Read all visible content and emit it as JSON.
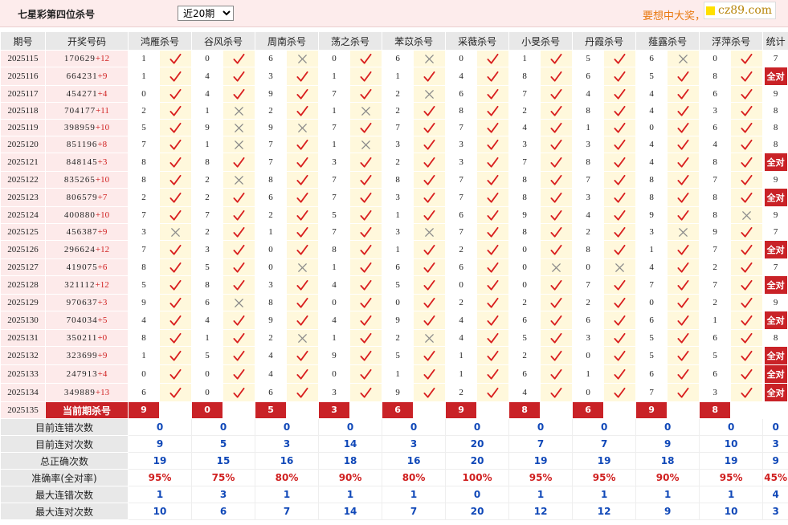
{
  "title": "七星彩第四位杀号",
  "period_select": {
    "value": "近20期"
  },
  "slogan": "要想中大奖，",
  "brand": "cz89.com",
  "headers": [
    "期号",
    "开奖号码",
    "鸿雁杀号",
    "谷风杀号",
    "周南杀号",
    "荡之杀号",
    "苯苡杀号",
    "采薇杀号",
    "小旻杀号",
    "丹霞杀号",
    "薤露杀号",
    "浮萍杀号",
    "统计"
  ],
  "rows": [
    {
      "period": "2025115",
      "digits": "170629",
      "add": "+12",
      "kills": [
        [
          "1",
          "y"
        ],
        [
          "0",
          "y"
        ],
        [
          "6",
          "n"
        ],
        [
          "0",
          "y"
        ],
        [
          "6",
          "n"
        ],
        [
          "0",
          "y"
        ],
        [
          "1",
          "y"
        ],
        [
          "5",
          "y"
        ],
        [
          "6",
          "n"
        ],
        [
          "0",
          "y"
        ]
      ],
      "stat": "7"
    },
    {
      "period": "2025116",
      "digits": "664231",
      "add": "+9",
      "kills": [
        [
          "1",
          "y"
        ],
        [
          "4",
          "y"
        ],
        [
          "3",
          "y"
        ],
        [
          "1",
          "y"
        ],
        [
          "1",
          "y"
        ],
        [
          "4",
          "y"
        ],
        [
          "8",
          "y"
        ],
        [
          "6",
          "y"
        ],
        [
          "5",
          "y"
        ],
        [
          "8",
          "y"
        ]
      ],
      "stat": "全对"
    },
    {
      "period": "2025117",
      "digits": "454271",
      "add": "+4",
      "kills": [
        [
          "0",
          "y"
        ],
        [
          "4",
          "y"
        ],
        [
          "9",
          "y"
        ],
        [
          "7",
          "y"
        ],
        [
          "2",
          "n"
        ],
        [
          "6",
          "y"
        ],
        [
          "7",
          "y"
        ],
        [
          "4",
          "y"
        ],
        [
          "4",
          "y"
        ],
        [
          "6",
          "y"
        ]
      ],
      "stat": "9"
    },
    {
      "period": "2025118",
      "digits": "704177",
      "add": "+11",
      "kills": [
        [
          "2",
          "y"
        ],
        [
          "1",
          "n"
        ],
        [
          "2",
          "y"
        ],
        [
          "1",
          "n"
        ],
        [
          "2",
          "y"
        ],
        [
          "8",
          "y"
        ],
        [
          "2",
          "y"
        ],
        [
          "8",
          "y"
        ],
        [
          "4",
          "y"
        ],
        [
          "3",
          "y"
        ]
      ],
      "stat": "8"
    },
    {
      "period": "2025119",
      "digits": "398959",
      "add": "+10",
      "kills": [
        [
          "5",
          "y"
        ],
        [
          "9",
          "n"
        ],
        [
          "9",
          "n"
        ],
        [
          "7",
          "y"
        ],
        [
          "7",
          "y"
        ],
        [
          "7",
          "y"
        ],
        [
          "4",
          "y"
        ],
        [
          "1",
          "y"
        ],
        [
          "0",
          "y"
        ],
        [
          "6",
          "y"
        ]
      ],
      "stat": "8"
    },
    {
      "period": "2025120",
      "digits": "851196",
      "add": "+8",
      "kills": [
        [
          "7",
          "y"
        ],
        [
          "1",
          "n"
        ],
        [
          "7",
          "y"
        ],
        [
          "1",
          "n"
        ],
        [
          "3",
          "y"
        ],
        [
          "3",
          "y"
        ],
        [
          "3",
          "y"
        ],
        [
          "3",
          "y"
        ],
        [
          "4",
          "y"
        ],
        [
          "4",
          "y"
        ]
      ],
      "stat": "8"
    },
    {
      "period": "2025121",
      "digits": "848145",
      "add": "+3",
      "kills": [
        [
          "8",
          "y"
        ],
        [
          "8",
          "y"
        ],
        [
          "7",
          "y"
        ],
        [
          "3",
          "y"
        ],
        [
          "2",
          "y"
        ],
        [
          "3",
          "y"
        ],
        [
          "7",
          "y"
        ],
        [
          "8",
          "y"
        ],
        [
          "4",
          "y"
        ],
        [
          "8",
          "y"
        ]
      ],
      "stat": "全对"
    },
    {
      "period": "2025122",
      "digits": "835265",
      "add": "+10",
      "kills": [
        [
          "8",
          "y"
        ],
        [
          "2",
          "n"
        ],
        [
          "8",
          "y"
        ],
        [
          "7",
          "y"
        ],
        [
          "8",
          "y"
        ],
        [
          "7",
          "y"
        ],
        [
          "8",
          "y"
        ],
        [
          "7",
          "y"
        ],
        [
          "8",
          "y"
        ],
        [
          "7",
          "y"
        ]
      ],
      "stat": "9"
    },
    {
      "period": "2025123",
      "digits": "806579",
      "add": "+7",
      "kills": [
        [
          "2",
          "y"
        ],
        [
          "2",
          "y"
        ],
        [
          "6",
          "y"
        ],
        [
          "7",
          "y"
        ],
        [
          "3",
          "y"
        ],
        [
          "7",
          "y"
        ],
        [
          "8",
          "y"
        ],
        [
          "3",
          "y"
        ],
        [
          "8",
          "y"
        ],
        [
          "8",
          "y"
        ]
      ],
      "stat": "全对"
    },
    {
      "period": "2025124",
      "digits": "400880",
      "add": "+10",
      "kills": [
        [
          "7",
          "y"
        ],
        [
          "7",
          "y"
        ],
        [
          "2",
          "y"
        ],
        [
          "5",
          "y"
        ],
        [
          "1",
          "y"
        ],
        [
          "6",
          "y"
        ],
        [
          "9",
          "y"
        ],
        [
          "4",
          "y"
        ],
        [
          "9",
          "y"
        ],
        [
          "8",
          "n"
        ]
      ],
      "stat": "9"
    },
    {
      "period": "2025125",
      "digits": "456387",
      "add": "+9",
      "kills": [
        [
          "3",
          "n"
        ],
        [
          "2",
          "y"
        ],
        [
          "1",
          "y"
        ],
        [
          "7",
          "y"
        ],
        [
          "3",
          "n"
        ],
        [
          "7",
          "y"
        ],
        [
          "8",
          "y"
        ],
        [
          "2",
          "y"
        ],
        [
          "3",
          "n"
        ],
        [
          "9",
          "y"
        ]
      ],
      "stat": "7"
    },
    {
      "period": "2025126",
      "digits": "296624",
      "add": "+12",
      "kills": [
        [
          "7",
          "y"
        ],
        [
          "3",
          "y"
        ],
        [
          "0",
          "y"
        ],
        [
          "8",
          "y"
        ],
        [
          "1",
          "y"
        ],
        [
          "2",
          "y"
        ],
        [
          "0",
          "y"
        ],
        [
          "8",
          "y"
        ],
        [
          "1",
          "y"
        ],
        [
          "7",
          "y"
        ]
      ],
      "stat": "全对"
    },
    {
      "period": "2025127",
      "digits": "419075",
      "add": "+6",
      "kills": [
        [
          "8",
          "y"
        ],
        [
          "5",
          "y"
        ],
        [
          "0",
          "n"
        ],
        [
          "1",
          "y"
        ],
        [
          "6",
          "y"
        ],
        [
          "6",
          "y"
        ],
        [
          "0",
          "n"
        ],
        [
          "0",
          "n"
        ],
        [
          "4",
          "y"
        ],
        [
          "2",
          "y"
        ]
      ],
      "stat": "7"
    },
    {
      "period": "2025128",
      "digits": "321112",
      "add": "+12",
      "kills": [
        [
          "5",
          "y"
        ],
        [
          "8",
          "y"
        ],
        [
          "3",
          "y"
        ],
        [
          "4",
          "y"
        ],
        [
          "5",
          "y"
        ],
        [
          "0",
          "y"
        ],
        [
          "0",
          "y"
        ],
        [
          "7",
          "y"
        ],
        [
          "7",
          "y"
        ],
        [
          "7",
          "y"
        ]
      ],
      "stat": "全对"
    },
    {
      "period": "2025129",
      "digits": "970637",
      "add": "+3",
      "kills": [
        [
          "9",
          "y"
        ],
        [
          "6",
          "n"
        ],
        [
          "8",
          "y"
        ],
        [
          "0",
          "y"
        ],
        [
          "0",
          "y"
        ],
        [
          "2",
          "y"
        ],
        [
          "2",
          "y"
        ],
        [
          "2",
          "y"
        ],
        [
          "0",
          "y"
        ],
        [
          "2",
          "y"
        ]
      ],
      "stat": "9"
    },
    {
      "period": "2025130",
      "digits": "704034",
      "add": "+5",
      "kills": [
        [
          "4",
          "y"
        ],
        [
          "4",
          "y"
        ],
        [
          "9",
          "y"
        ],
        [
          "4",
          "y"
        ],
        [
          "9",
          "y"
        ],
        [
          "4",
          "y"
        ],
        [
          "6",
          "y"
        ],
        [
          "6",
          "y"
        ],
        [
          "6",
          "y"
        ],
        [
          "1",
          "y"
        ]
      ],
      "stat": "全对"
    },
    {
      "period": "2025131",
      "digits": "350211",
      "add": "+0",
      "kills": [
        [
          "8",
          "y"
        ],
        [
          "1",
          "y"
        ],
        [
          "2",
          "n"
        ],
        [
          "1",
          "y"
        ],
        [
          "2",
          "n"
        ],
        [
          "4",
          "y"
        ],
        [
          "5",
          "y"
        ],
        [
          "3",
          "y"
        ],
        [
          "5",
          "y"
        ],
        [
          "6",
          "y"
        ]
      ],
      "stat": "8"
    },
    {
      "period": "2025132",
      "digits": "323699",
      "add": "+9",
      "kills": [
        [
          "1",
          "y"
        ],
        [
          "5",
          "y"
        ],
        [
          "4",
          "y"
        ],
        [
          "9",
          "y"
        ],
        [
          "5",
          "y"
        ],
        [
          "1",
          "y"
        ],
        [
          "2",
          "y"
        ],
        [
          "0",
          "y"
        ],
        [
          "5",
          "y"
        ],
        [
          "5",
          "y"
        ]
      ],
      "stat": "全对"
    },
    {
      "period": "2025133",
      "digits": "247913",
      "add": "+4",
      "kills": [
        [
          "0",
          "y"
        ],
        [
          "0",
          "y"
        ],
        [
          "4",
          "y"
        ],
        [
          "0",
          "y"
        ],
        [
          "1",
          "y"
        ],
        [
          "1",
          "y"
        ],
        [
          "6",
          "y"
        ],
        [
          "1",
          "y"
        ],
        [
          "6",
          "y"
        ],
        [
          "6",
          "y"
        ]
      ],
      "stat": "全对"
    },
    {
      "period": "2025134",
      "digits": "349889",
      "add": "+13",
      "kills": [
        [
          "6",
          "y"
        ],
        [
          "0",
          "y"
        ],
        [
          "6",
          "y"
        ],
        [
          "3",
          "y"
        ],
        [
          "9",
          "y"
        ],
        [
          "2",
          "y"
        ],
        [
          "4",
          "y"
        ],
        [
          "0",
          "y"
        ],
        [
          "7",
          "y"
        ],
        [
          "3",
          "y"
        ]
      ],
      "stat": "全对"
    }
  ],
  "current": {
    "period": "2025135",
    "label": "当前期杀号",
    "preds": [
      "9",
      "0",
      "5",
      "3",
      "6",
      "9",
      "8",
      "6",
      "9",
      "8"
    ]
  },
  "stats": [
    {
      "label": "目前连错次数",
      "values": [
        "0",
        "0",
        "0",
        "0",
        "0",
        "0",
        "0",
        "0",
        "0",
        "0",
        "0"
      ],
      "red": false
    },
    {
      "label": "目前连对次数",
      "values": [
        "9",
        "5",
        "3",
        "14",
        "3",
        "20",
        "7",
        "7",
        "9",
        "10",
        "3"
      ],
      "red": false
    },
    {
      "label": "总正确次数",
      "values": [
        "19",
        "15",
        "16",
        "18",
        "16",
        "20",
        "19",
        "19",
        "18",
        "19",
        "9"
      ],
      "red": false
    },
    {
      "label": "准确率(全对率)",
      "values": [
        "95%",
        "75%",
        "80%",
        "90%",
        "80%",
        "100%",
        "95%",
        "95%",
        "90%",
        "95%",
        "45%"
      ],
      "red": true
    },
    {
      "label": "最大连错次数",
      "values": [
        "1",
        "3",
        "1",
        "1",
        "1",
        "0",
        "1",
        "1",
        "1",
        "1",
        "4"
      ],
      "red": false
    },
    {
      "label": "最大连对次数",
      "values": [
        "10",
        "6",
        "7",
        "14",
        "7",
        "20",
        "12",
        "12",
        "9",
        "10",
        "3"
      ],
      "red": false
    }
  ],
  "colors": {
    "check": "#d92020",
    "cross": "#8a8a8a",
    "accent_red": "#c92227",
    "stat_blue": "#1048b8"
  },
  "icons": {
    "hit": "check-icon",
    "miss": "cross-icon"
  }
}
